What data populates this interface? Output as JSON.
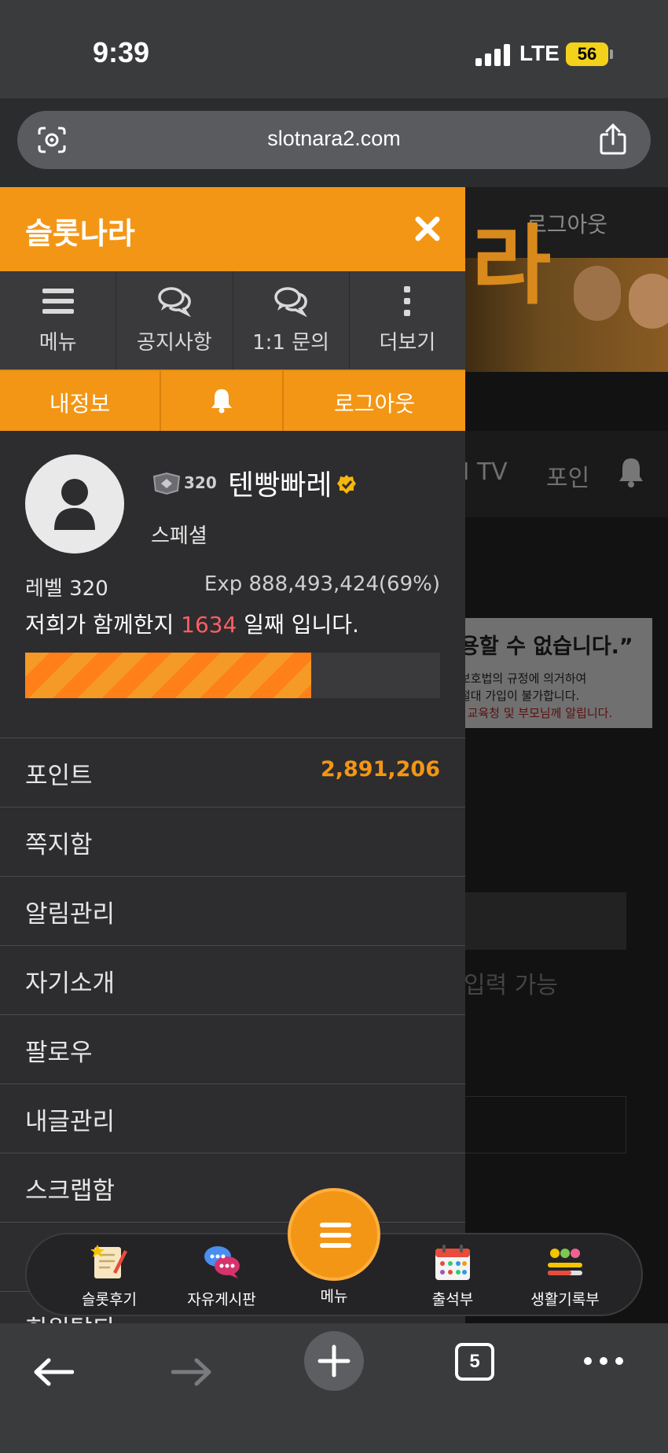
{
  "status_bar": {
    "time": "9:39",
    "network": "LTE",
    "battery": "56"
  },
  "browser": {
    "url": "slotnara2.com",
    "tab_count": "5"
  },
  "background_page": {
    "logout": "로그아웃",
    "nav_items": [
      "N TV",
      "포인"
    ],
    "warning_title": "용할 수 없습니다.”",
    "warning_lines": [
      "보호법의 규정에 의거하여",
      "절대 가입이 불가합니다.",
      ", 교육청 및 부모님께 알립니다."
    ],
    "input_hint": "입력 가능",
    "banner_glyph": "라"
  },
  "drawer": {
    "title": "슬롯나라",
    "quick_menu": [
      {
        "label": "메뉴",
        "icon": "hamburger-icon"
      },
      {
        "label": "공지사항",
        "icon": "chat-bubbles-icon"
      },
      {
        "label": "1:1 문의",
        "icon": "chat-bubbles-icon"
      },
      {
        "label": "더보기",
        "icon": "vertical-dots-icon"
      }
    ],
    "account_bar": {
      "my_info": "내정보",
      "notifications_icon": "bell-icon",
      "logout": "로그아웃"
    },
    "profile": {
      "level_badge": "320",
      "nickname": "텐빵빠레",
      "grade": "스페셜",
      "level": "레벨 320",
      "exp": "Exp 888,493,424(69%)",
      "together_prefix": "저희가 함께한지 ",
      "days": "1634",
      "together_suffix": " 일째 입니다.",
      "exp_progress": 0.69
    },
    "menu_items": [
      {
        "label": "포인트",
        "value": "2,891,206"
      },
      {
        "label": "쪽지함",
        "value": ""
      },
      {
        "label": "알림관리",
        "value": ""
      },
      {
        "label": "자기소개",
        "value": ""
      },
      {
        "label": "팔로우",
        "value": ""
      },
      {
        "label": "내글관리",
        "value": ""
      },
      {
        "label": "스크랩함",
        "value": ""
      },
      {
        "label": "",
        "value": ""
      },
      {
        "label": "회원탈퇴",
        "value": ""
      }
    ]
  },
  "dock": {
    "items": [
      {
        "label": "슬롯후기",
        "icon": "notepad-icon"
      },
      {
        "label": "자유게시판",
        "icon": "chat-bubbles-icon"
      },
      {
        "label": "메뉴",
        "icon": "hamburger-icon"
      },
      {
        "label": "출석부",
        "icon": "calendar-icon"
      },
      {
        "label": "생활기록부",
        "icon": "emoji-meter-icon"
      }
    ]
  },
  "colors": {
    "accent": "#f39615",
    "days_highlight": "#ff5e63",
    "drawer_bg": "#2d2d2f"
  }
}
